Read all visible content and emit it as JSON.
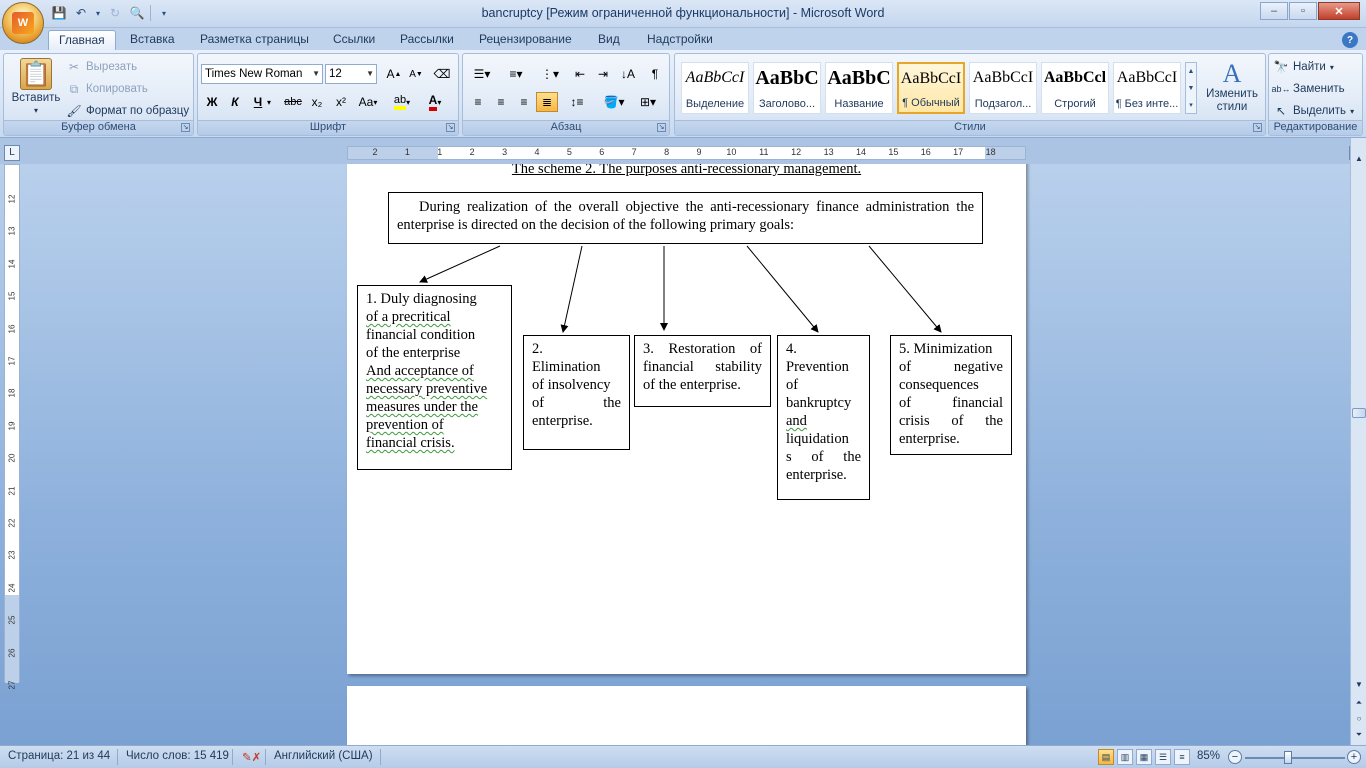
{
  "window": {
    "title": "bancruptcy [Режим ограниченной функциональности] - Microsoft Word",
    "controls": [
      "–",
      "▫",
      "✕"
    ]
  },
  "ribbon": {
    "tabs": [
      "Главная",
      "Вставка",
      "Разметка страницы",
      "Ссылки",
      "Рассылки",
      "Рецензирование",
      "Вид",
      "Надстройки"
    ],
    "active_tab": "Главная",
    "clipboard": {
      "paste": "Вставить",
      "cut": "Вырезать",
      "copy": "Копировать",
      "format_painter": "Формат по образцу",
      "label": "Буфер обмена"
    },
    "font": {
      "font_name": "Times New Roman",
      "font_size": "12",
      "bold": "Ж",
      "italic": "К",
      "underline": "Ч",
      "strike": "abc",
      "subscript": "x₂",
      "superscript": "x²",
      "change_case": "Aa",
      "label": "Шрифт"
    },
    "paragraph": {
      "label": "Абзац"
    },
    "styles": {
      "items": [
        {
          "preview": "AaBbCcI",
          "name": "Выделение"
        },
        {
          "preview": "AaBbC",
          "name": "Заголово..."
        },
        {
          "preview": "AaBbC",
          "name": "Название"
        },
        {
          "preview": "AaBbCcI",
          "name": "¶ Обычный"
        },
        {
          "preview": "AaBbCcI",
          "name": "Подзагол..."
        },
        {
          "preview": "AaBbCcl",
          "name": "Строгий"
        },
        {
          "preview": "AaBbCcI",
          "name": "¶ Без инте..."
        }
      ],
      "selected_index": 3,
      "change_styles": "Изменить стили",
      "label": "Стили"
    },
    "editing": {
      "find": "Найти",
      "replace": "Заменить",
      "select": "Выделить",
      "label": "Редактирование"
    }
  },
  "ruler": {
    "horizontal": [
      "2",
      "1",
      "1",
      "2",
      "3",
      "4",
      "5",
      "6",
      "7",
      "8",
      "9",
      "10",
      "11",
      "12",
      "13",
      "14",
      "15",
      "16",
      "17",
      "18"
    ],
    "vertical": [
      "12",
      "13",
      "14",
      "15",
      "16",
      "17",
      "18",
      "19",
      "20",
      "21",
      "22",
      "23",
      "24",
      "25",
      "26",
      "27"
    ]
  },
  "document": {
    "caption": "The scheme 2. The purposes anti-recessionary management.",
    "main_goal": [
      "During realization of the overall objective the anti-recessionary finance administration",
      "the enterprise is directed on the decision of the following primary goals:"
    ],
    "goals": [
      [
        "1. Duly diagnosing",
        "of a precritical",
        "financial condition",
        "of the enterprise",
        "And acceptance of",
        "necessary preventive",
        "measures under the",
        "prevention of",
        "financial crisis."
      ],
      [
        "2.",
        "Elimination",
        "of insolvency",
        "of the",
        "enterprise."
      ],
      [
        "3. Restoration of",
        "financial stability",
        "of the enterprise."
      ],
      [
        "4.",
        "Prevention",
        "of",
        "bankruptcy",
        "and",
        "liquidation",
        "s of the",
        "enterprise."
      ],
      [
        "5. Minimization",
        "of negative",
        "consequences",
        "of financial",
        "crisis of the",
        "enterprise."
      ]
    ]
  },
  "statusbar": {
    "page": "Страница: 21 из 44",
    "words": "Число слов: 15 419",
    "language": "Английский (США)",
    "zoom": "85%"
  },
  "colors": {
    "ribbon": "#d8e5f5",
    "doc_background": "#8eb1dc",
    "selected_style": "#e8a628"
  }
}
